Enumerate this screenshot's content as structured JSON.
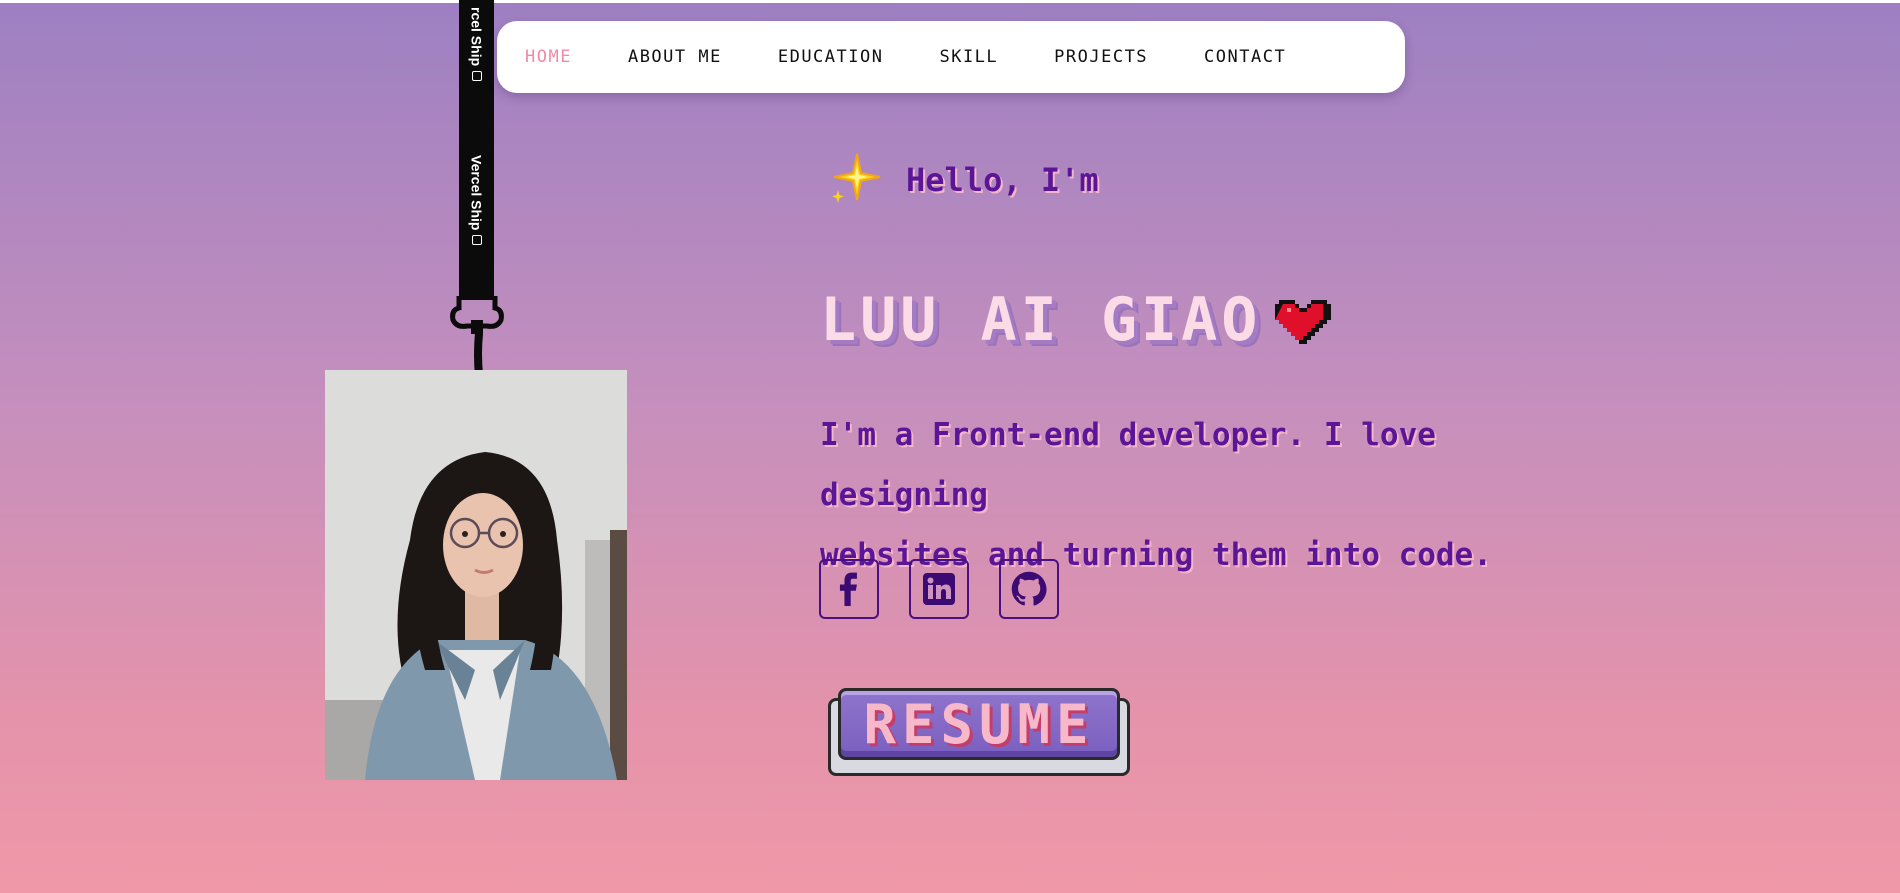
{
  "nav": {
    "items": [
      {
        "label": "HOME",
        "active": true
      },
      {
        "label": "ABOUT ME",
        "active": false
      },
      {
        "label": "EDUCATION",
        "active": false
      },
      {
        "label": "SKILL",
        "active": false
      },
      {
        "label": "PROJECTS",
        "active": false
      },
      {
        "label": "CONTACT",
        "active": false
      }
    ]
  },
  "lanyard": {
    "strap_text_1": "rcel Ship",
    "strap_text_2": "Vercel Ship"
  },
  "hero": {
    "greeting": "Hello, I'm",
    "name": "LUU AI GIAO",
    "tagline_line1": "I'm a Front-end developer. I love designing",
    "tagline_line2": "websites and turning them into code.",
    "resume_label": "RESUME"
  },
  "socials": [
    {
      "icon": "facebook-icon"
    },
    {
      "icon": "linkedin-icon"
    },
    {
      "icon": "github-icon"
    }
  ],
  "colors": {
    "bg_top": "#9d80c2",
    "bg_bottom": "#f098a8",
    "accent_purple": "#5b1597",
    "nav_active": "#f08aa6",
    "name_pink": "#fbdce6",
    "heart_red": "#e0102a"
  }
}
